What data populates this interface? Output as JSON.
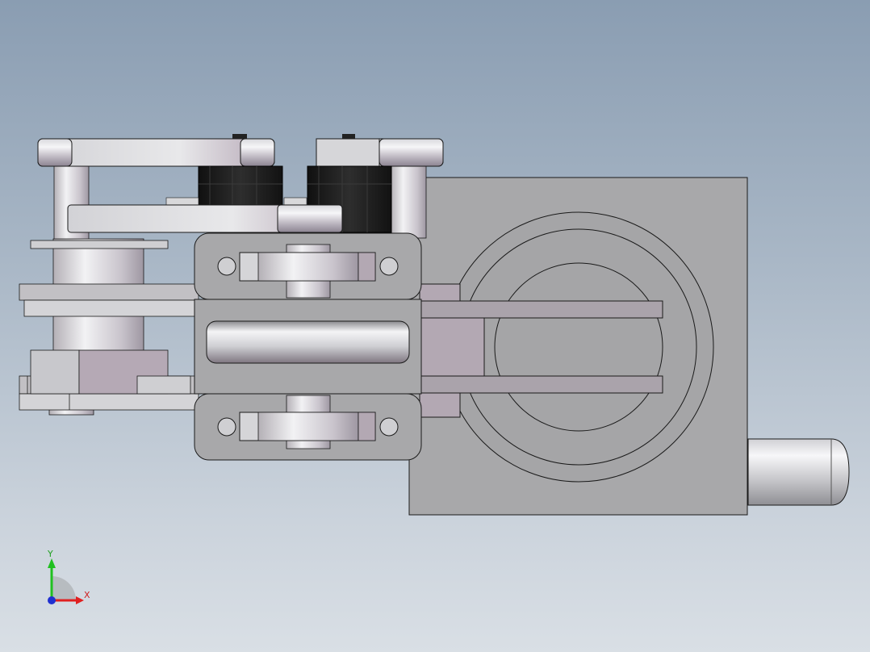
{
  "viewport": {
    "background_top": "#8a9db2",
    "background_bottom": "#d9dfe5"
  },
  "triad": {
    "x_label": "X",
    "y_label": "Y",
    "x_color": "#e02020",
    "y_color": "#20c020",
    "z_color": "#2030d0"
  },
  "colors": {
    "housing": "#a7a7a9",
    "edge": "#1a1a1a",
    "steel_light": "#e3e3e6",
    "steel_mid": "#c4c2c8",
    "steel_pink": "#b9abb7",
    "motor_black": "#1c1c1c"
  }
}
